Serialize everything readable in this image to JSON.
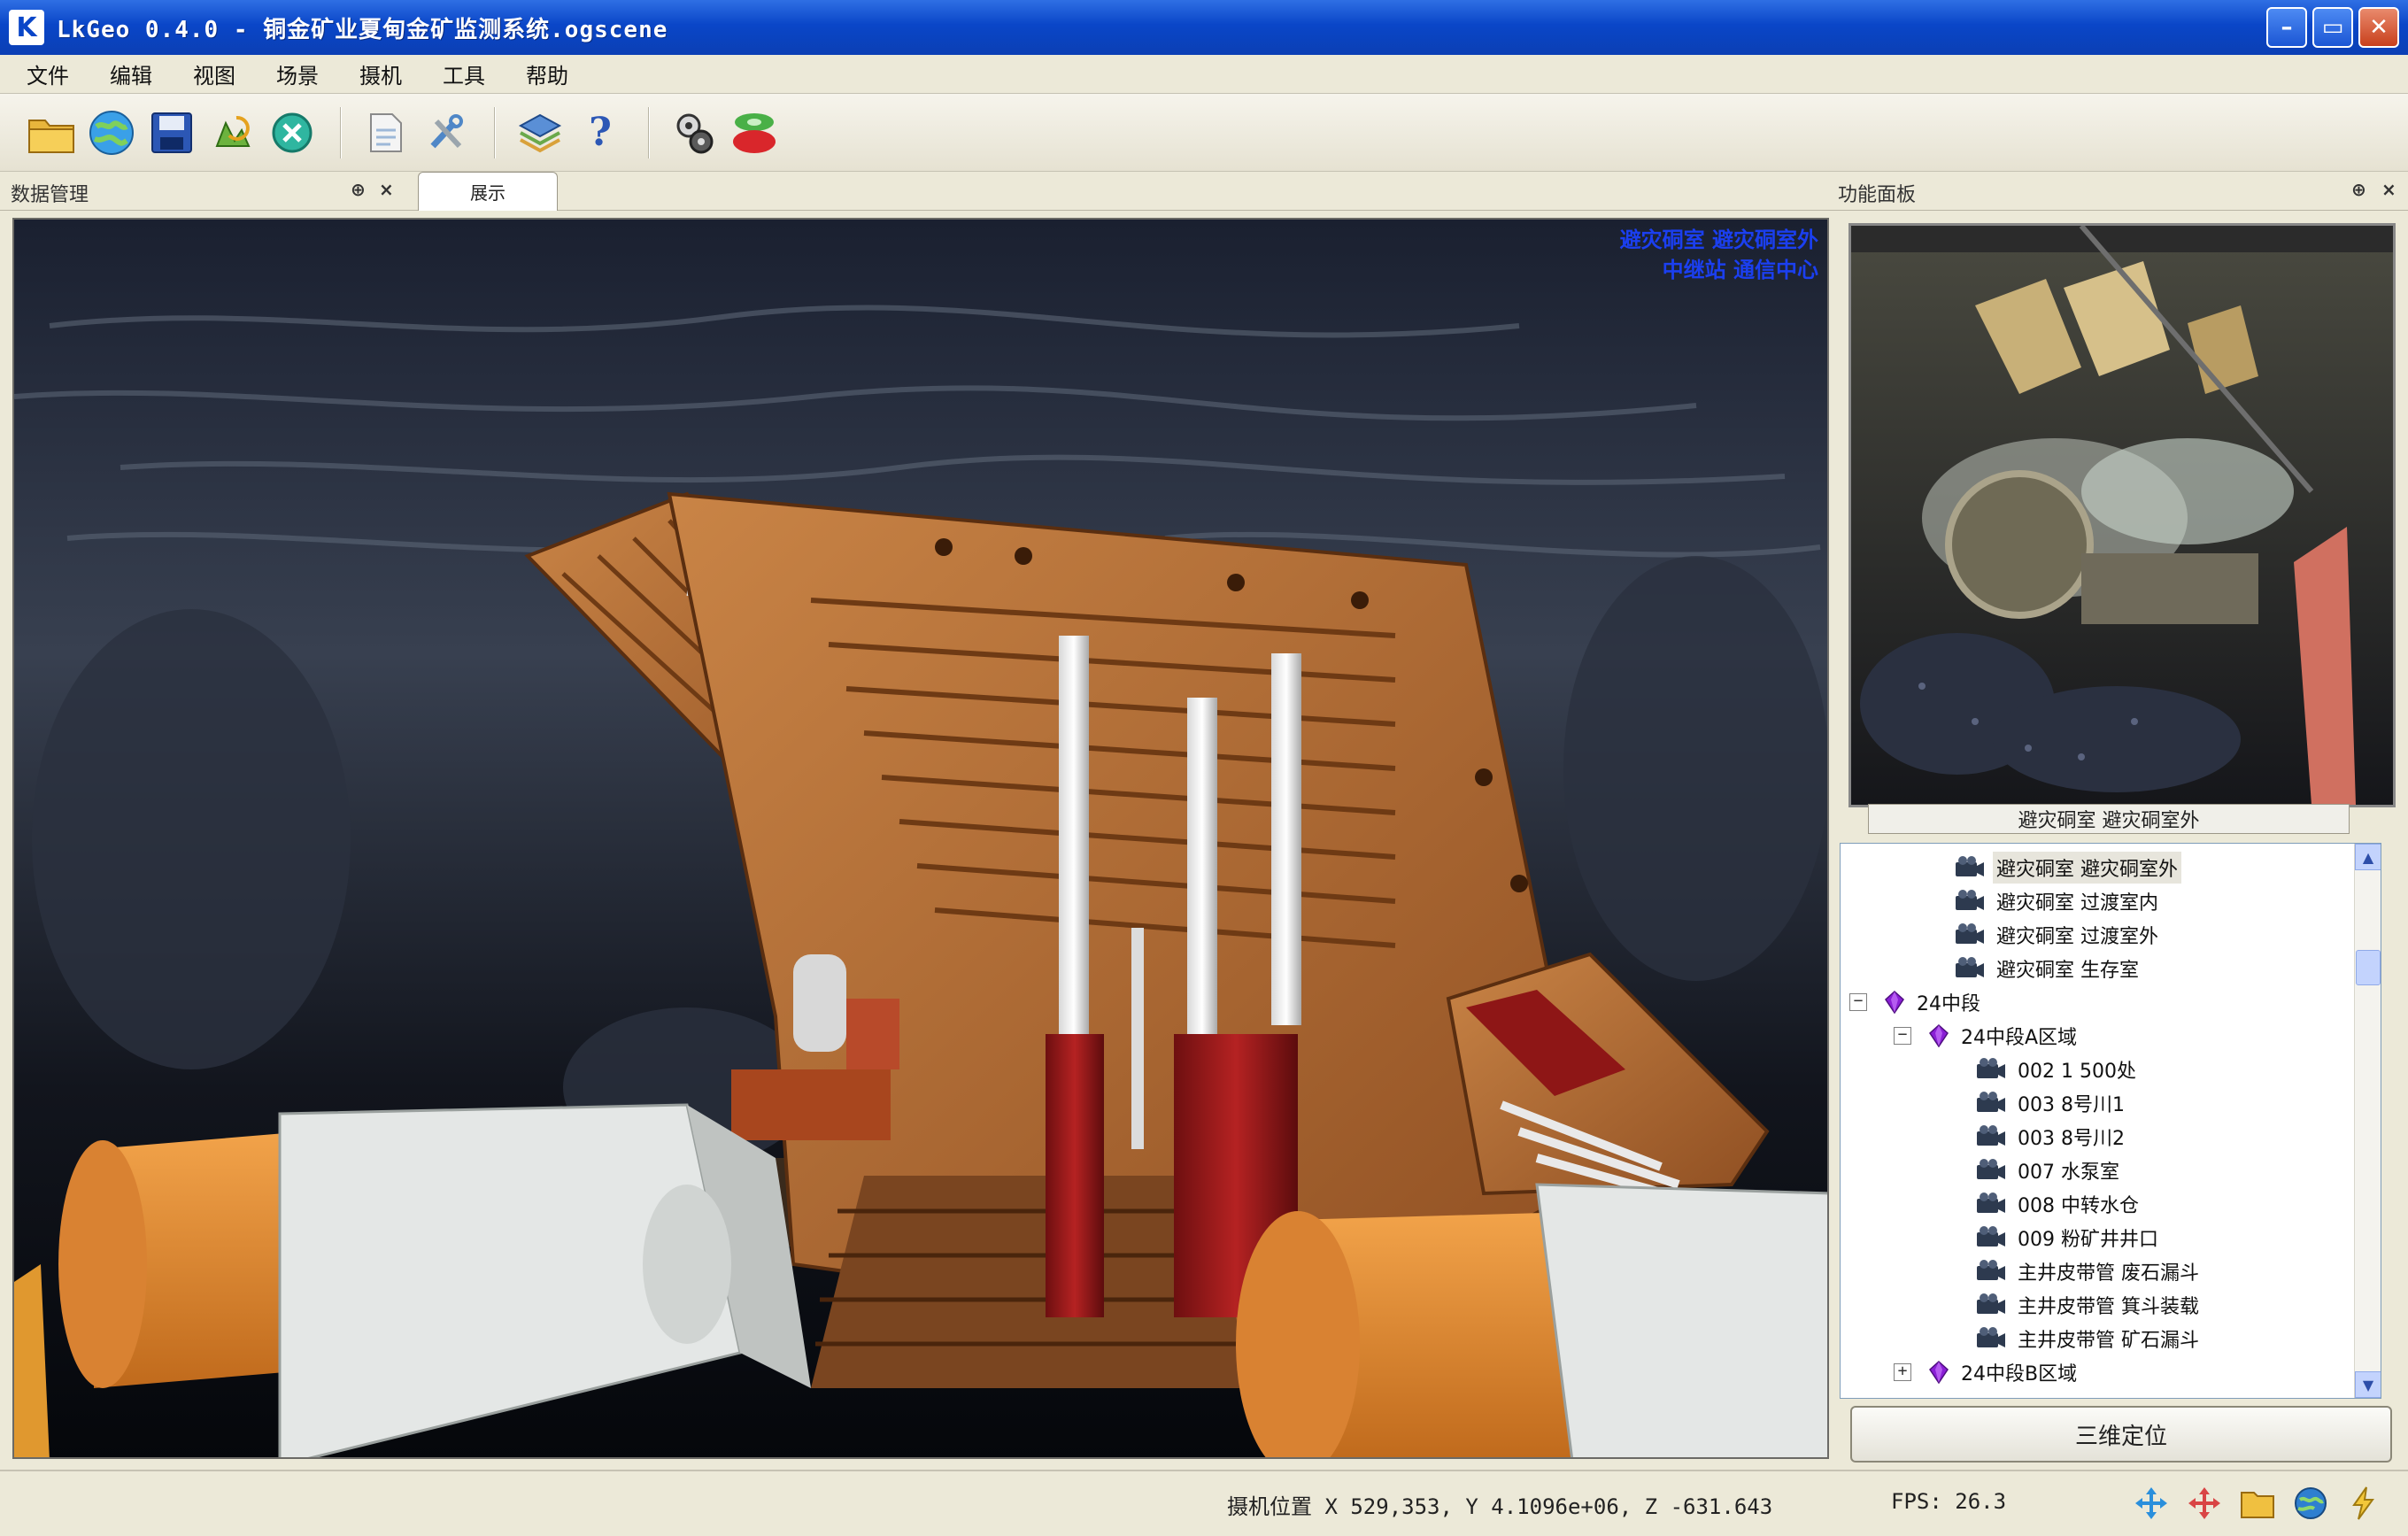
{
  "window": {
    "title": "LkGeo 0.4.0 - 铜金矿业夏甸金矿监测系统.ogscene",
    "logo_letter": "K",
    "minimize": "–",
    "maximize": "▭",
    "close": "✕"
  },
  "menu": [
    "文件",
    "编辑",
    "视图",
    "场景",
    "摄机",
    "工具",
    "帮助"
  ],
  "toolbar": {
    "icons": [
      "open-folder-icon",
      "globe-icon",
      "save-icon",
      "refresh-icon",
      "stop-icon",
      "document-icon",
      "tools-icon",
      "layers-icon",
      "help-icon",
      "settings-icon",
      "traffic-light-icon"
    ],
    "help_glyph": "?"
  },
  "dock": {
    "left_title": "数据管理",
    "doc_tab": "展示",
    "right_title": "功能面板",
    "pin": "⊕",
    "close": "×"
  },
  "viewport": {
    "overlay_lines": [
      "避灾硐室 避灾硐室外",
      "中继站 通信中心"
    ]
  },
  "preview": {
    "caption": "避灾硐室 避灾硐室外"
  },
  "tree": {
    "items": [
      {
        "label": "避灾硐室 避灾硐室外",
        "icon": "camera-icon",
        "level": 2,
        "selected": true
      },
      {
        "label": "避灾硐室 过渡室内",
        "icon": "camera-icon",
        "level": 2
      },
      {
        "label": "避灾硐室 过渡室外",
        "icon": "camera-icon",
        "level": 2
      },
      {
        "label": "避灾硐室 生存室",
        "icon": "camera-icon",
        "level": 2
      },
      {
        "label": "24中段",
        "icon": "gem-icon",
        "level": 0,
        "expander": "−"
      },
      {
        "label": "24中段A区域",
        "icon": "gem-icon",
        "level": 1,
        "expander": "−"
      },
      {
        "label": "002 1 500处",
        "icon": "camera-icon",
        "level": 3
      },
      {
        "label": "003 8号川1",
        "icon": "camera-icon",
        "level": 3
      },
      {
        "label": "003 8号川2",
        "icon": "camera-icon",
        "level": 3
      },
      {
        "label": "007 水泵室",
        "icon": "camera-icon",
        "level": 3
      },
      {
        "label": "008 中转水仓",
        "icon": "camera-icon",
        "level": 3
      },
      {
        "label": "009 粉矿井井口",
        "icon": "camera-icon",
        "level": 3
      },
      {
        "label": "主井皮带管 废石漏斗",
        "icon": "camera-icon",
        "level": 3
      },
      {
        "label": "主井皮带管 箕斗装载",
        "icon": "camera-icon",
        "level": 3
      },
      {
        "label": "主井皮带管 矿石漏斗",
        "icon": "camera-icon",
        "level": 3
      },
      {
        "label": "24中段B区域",
        "icon": "gem-icon",
        "level": 1,
        "expander": "+"
      }
    ]
  },
  "locate_button": "三维定位",
  "status": {
    "camera_position": "摄机位置 X 529,353, Y 4.1096e+06, Z -631.643",
    "fps": "FPS: 26.3"
  },
  "colors": {
    "titlebar": "#0a46c8",
    "chrome": "#ece9d8",
    "support_orange": "#b86a32",
    "hydraulic_red": "#9c1d1d",
    "overlay_blue": "#1b3ff0"
  }
}
